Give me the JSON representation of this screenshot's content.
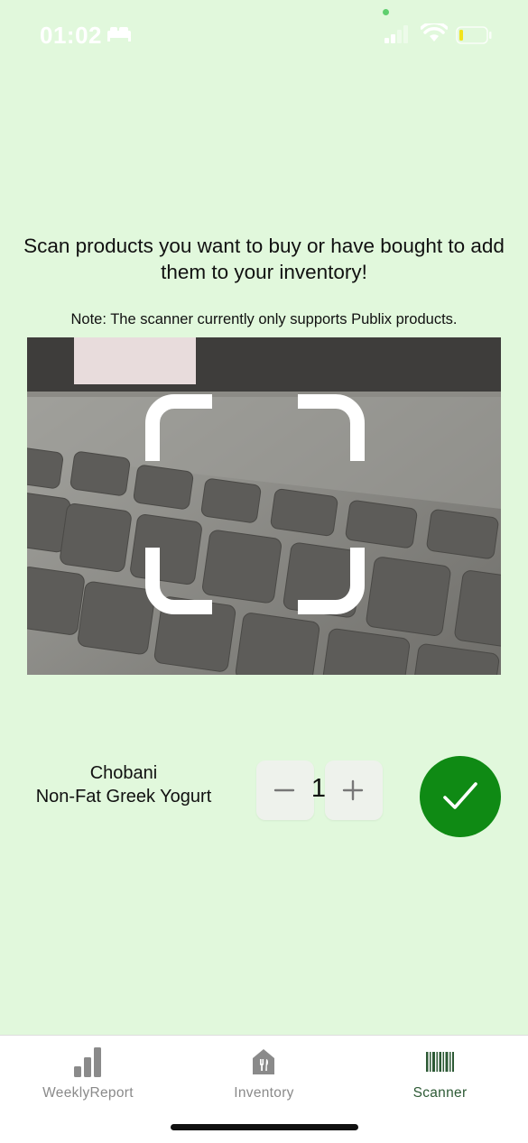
{
  "status_bar": {
    "time": "01:02",
    "icons": [
      "bed-icon",
      "signal-icon",
      "wifi-icon",
      "battery-icon"
    ]
  },
  "scanner": {
    "headline": "Scan products you want to buy or have bought to add them to your inventory!",
    "note": "Note: The scanner currently only supports Publix products."
  },
  "product": {
    "brand": "Chobani",
    "name": "Non-Fat Greek Yogurt",
    "quantity": "1",
    "minus_icon": "minus-icon",
    "plus_icon": "plus-icon",
    "confirm_icon": "checkmark-icon"
  },
  "tab_bar": {
    "tabs": [
      {
        "label": "WeeklyReport",
        "icon": "bar-chart-icon",
        "active": false
      },
      {
        "label": "Inventory",
        "icon": "house-fork-knife-icon",
        "active": false
      },
      {
        "label": "Scanner",
        "icon": "barcode-icon",
        "active": true
      }
    ]
  },
  "colors": {
    "background": "#e1f8dc",
    "accent": "#0f8a14",
    "active_tab": "#2d5a35",
    "inactive_tab": "#8a8a8a"
  }
}
